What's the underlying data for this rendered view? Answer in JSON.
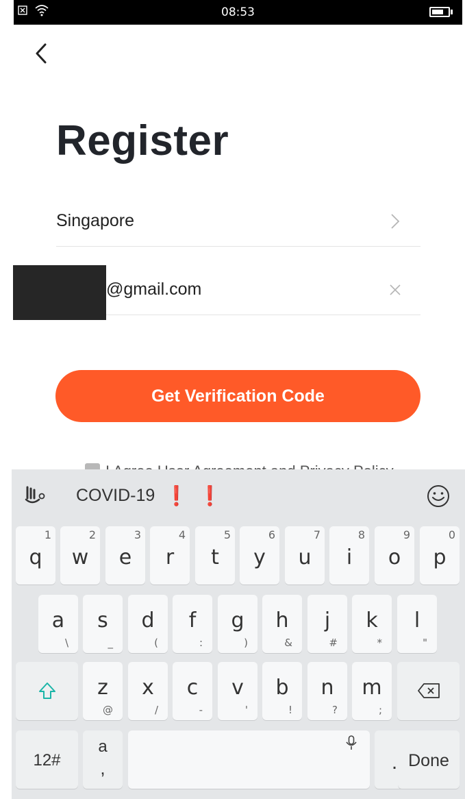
{
  "status_bar": {
    "time": "08:53"
  },
  "page": {
    "title": "Register"
  },
  "form": {
    "country": "Singapore",
    "email_suffix": "@gmail.com"
  },
  "actions": {
    "verify_label": "Get Verification Code"
  },
  "agreement": {
    "text": "I Agree User Agreement and Privacy Policy"
  },
  "keyboard": {
    "suggestion": "COVID-19",
    "suggestion_marks": [
      "❗",
      "❗"
    ],
    "row1": [
      {
        "key": "q",
        "hint": "1"
      },
      {
        "key": "w",
        "hint": "2"
      },
      {
        "key": "e",
        "hint": "3"
      },
      {
        "key": "r",
        "hint": "4"
      },
      {
        "key": "t",
        "hint": "5"
      },
      {
        "key": "y",
        "hint": "6"
      },
      {
        "key": "u",
        "hint": "7"
      },
      {
        "key": "i",
        "hint": "8"
      },
      {
        "key": "o",
        "hint": "9"
      },
      {
        "key": "p",
        "hint": "0"
      }
    ],
    "row2": [
      {
        "key": "a",
        "hint": "\\"
      },
      {
        "key": "s",
        "hint": "_"
      },
      {
        "key": "d",
        "hint": "("
      },
      {
        "key": "f",
        "hint": ":"
      },
      {
        "key": "g",
        "hint": ")"
      },
      {
        "key": "h",
        "hint": "&"
      },
      {
        "key": "j",
        "hint": "#"
      },
      {
        "key": "k",
        "hint": "*"
      },
      {
        "key": "l",
        "hint": "\""
      }
    ],
    "row3": [
      {
        "key": "z",
        "hint": "@"
      },
      {
        "key": "x",
        "hint": "/"
      },
      {
        "key": "c",
        "hint": "-"
      },
      {
        "key": "v",
        "hint": "'"
      },
      {
        "key": "b",
        "hint": "!"
      },
      {
        "key": "n",
        "hint": "?"
      },
      {
        "key": "m",
        "hint": ";"
      }
    ],
    "row4": {
      "numbers": "12#",
      "lang_top": "a",
      "lang_bottom": ",",
      "period": ".",
      "done": "Done"
    }
  },
  "colors": {
    "accent": "#ff5a28",
    "title": "#22252b",
    "shift": "#1ab5a8"
  }
}
